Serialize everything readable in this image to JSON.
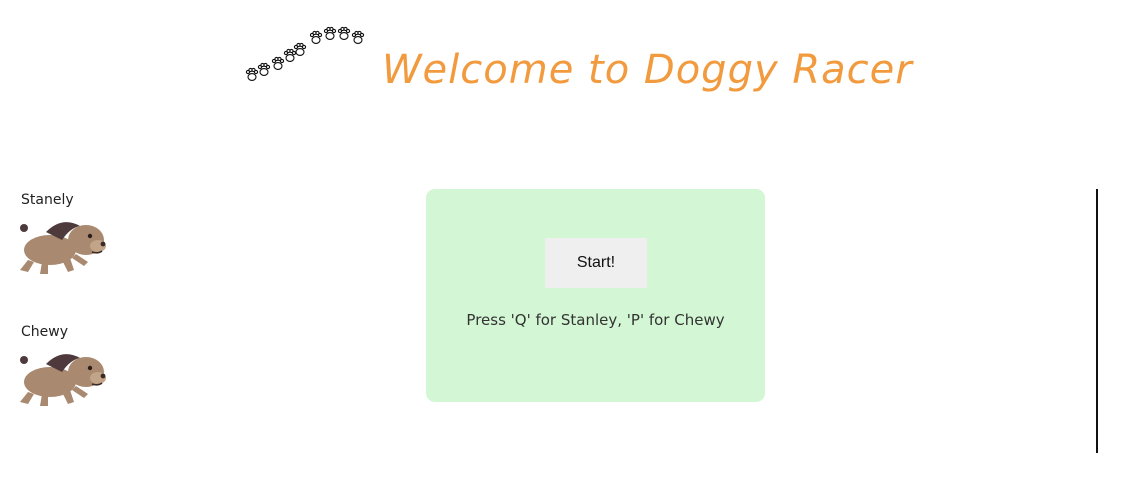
{
  "header": {
    "title": "Welcome to Doggy Racer",
    "title_color": "#f19a3e",
    "paw_icon": "paw-trail-icon"
  },
  "racers": [
    {
      "name": "Stanely",
      "icon": "dog-icon",
      "key": "Q"
    },
    {
      "name": "Chewy",
      "icon": "dog-icon",
      "key": "P"
    }
  ],
  "start_panel": {
    "button_label": "Start!",
    "instructions": "Press 'Q' for Stanley, 'P' for Chewy",
    "background": "#d3f6d4"
  },
  "finish_line": {
    "icon": "finish-line"
  }
}
